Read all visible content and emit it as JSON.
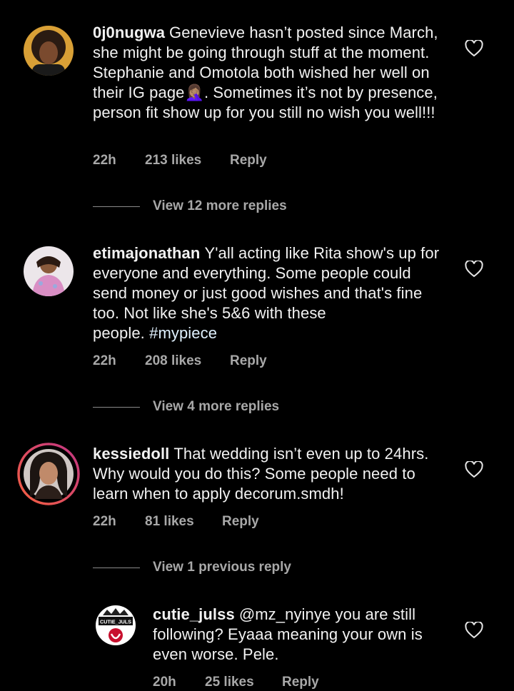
{
  "comments": [
    {
      "username": "0j0nugwa",
      "text": "Genevieve hasn’t posted since March, she might be going through stuff at the moment. Stephanie and Omotola both wished her well on their IG page",
      "emoji": "🤦🏽‍♀️",
      "text_after": ". Sometimes it’s not by presence, person fit show up for you still no wish you well!!!",
      "time": "22h",
      "likes": "213 likes",
      "reply": "Reply",
      "view_more": "View 12 more replies"
    },
    {
      "username": "etimajonathan",
      "text": "Y'all acting like Rita show's up for everyone and everything. Some people could send money or just good wishes and that's fine too. Not like she's 5&6 with these people.",
      "hashtag": "#mypiece",
      "time": "22h",
      "likes": "208 likes",
      "reply": "Reply",
      "view_more": "View 4 more replies"
    },
    {
      "username": "kessiedoll",
      "text": "That wedding isn’t even up to 24hrs. Why would you do this? Some people need to learn when to apply decorum.smdh!",
      "time": "22h",
      "likes": "81 likes",
      "reply": "Reply",
      "view_more": "View 1 previous reply"
    },
    {
      "username": "cutie_julss",
      "avatar_text": "CUTIE_JULS",
      "text": "@mz_nyinye you are still following? Eyaaa meaning your own is even worse. Pele.",
      "time": "20h",
      "likes": "25 likes",
      "reply": "Reply"
    }
  ],
  "colors": {
    "background": "#000000",
    "text": "#f2f2f2",
    "meta": "#a8a8a8",
    "story_ring_start": "#c13584",
    "story_ring_end": "#f56040"
  }
}
